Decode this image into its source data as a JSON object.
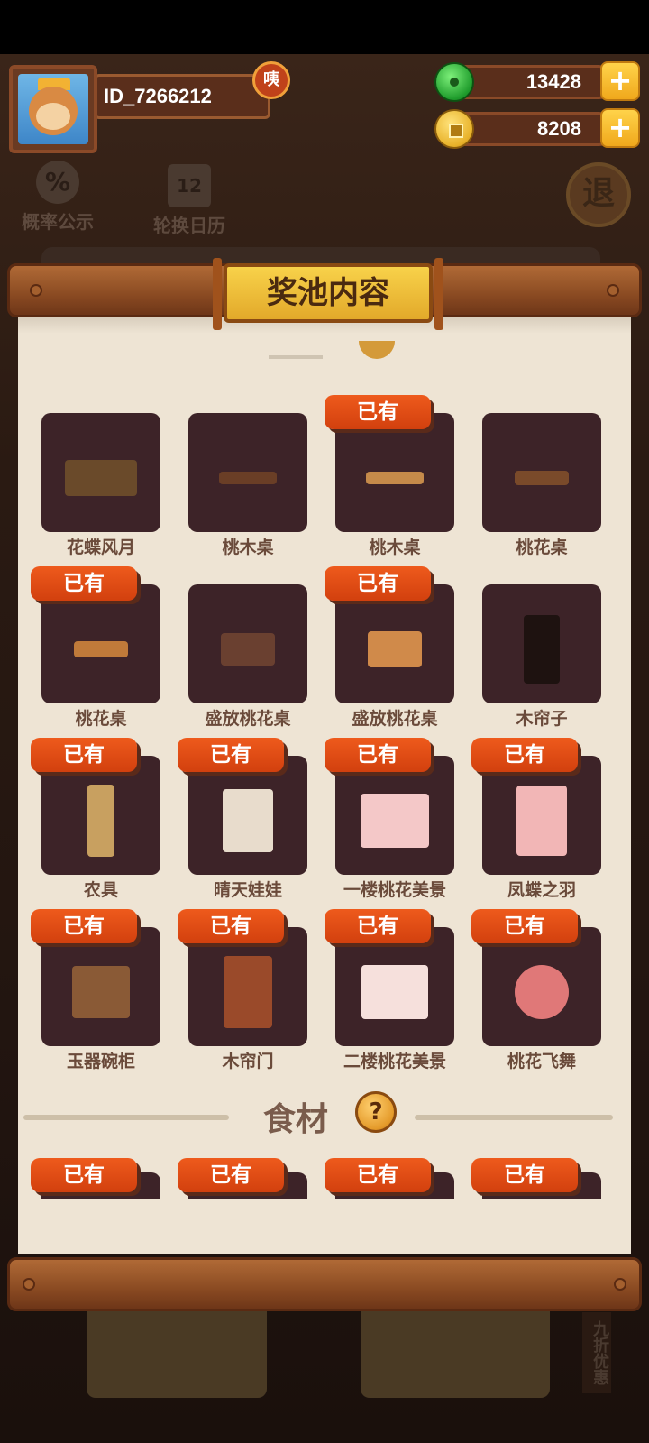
{
  "header": {
    "user_id": "ID_7266212",
    "badge": "咦",
    "jade_count": "13428",
    "coin_count": "8208",
    "plus": "+"
  },
  "side": {
    "probability": "概率公示",
    "probability_icon": "%",
    "calendar": "轮换日历",
    "calendar_icon": "12",
    "exit": "退"
  },
  "bottom": {
    "discount": "九折优惠"
  },
  "modal": {
    "title": "奖池内容",
    "owned_label": "已有",
    "items": [
      {
        "name": "花蝶风月",
        "owned": false
      },
      {
        "name": "桃木桌",
        "owned": false
      },
      {
        "name": "桃木桌",
        "owned": true
      },
      {
        "name": "桃花桌",
        "owned": false
      },
      {
        "name": "桃花桌",
        "owned": true
      },
      {
        "name": "盛放桃花桌",
        "owned": false
      },
      {
        "name": "盛放桃花桌",
        "owned": true
      },
      {
        "name": "木帘子",
        "owned": false
      },
      {
        "name": "农具",
        "owned": true
      },
      {
        "name": "晴天娃娃",
        "owned": true
      },
      {
        "name": "一楼桃花美景",
        "owned": true
      },
      {
        "name": "凤蝶之羽",
        "owned": true
      },
      {
        "name": "玉器碗柜",
        "owned": true
      },
      {
        "name": "木帘门",
        "owned": true
      },
      {
        "name": "二楼桃花美景",
        "owned": true
      },
      {
        "name": "桃花飞舞",
        "owned": true
      }
    ],
    "food_section": {
      "title": "食材",
      "help": "?",
      "items": [
        {
          "owned": true
        },
        {
          "owned": true
        },
        {
          "owned": true
        },
        {
          "owned": true
        }
      ]
    }
  },
  "colors": {
    "card_bg": "#3d2328",
    "tag_orange": "#e04e16",
    "panel_bg": "#eee4d4",
    "title_gold": "#f2c53a"
  }
}
